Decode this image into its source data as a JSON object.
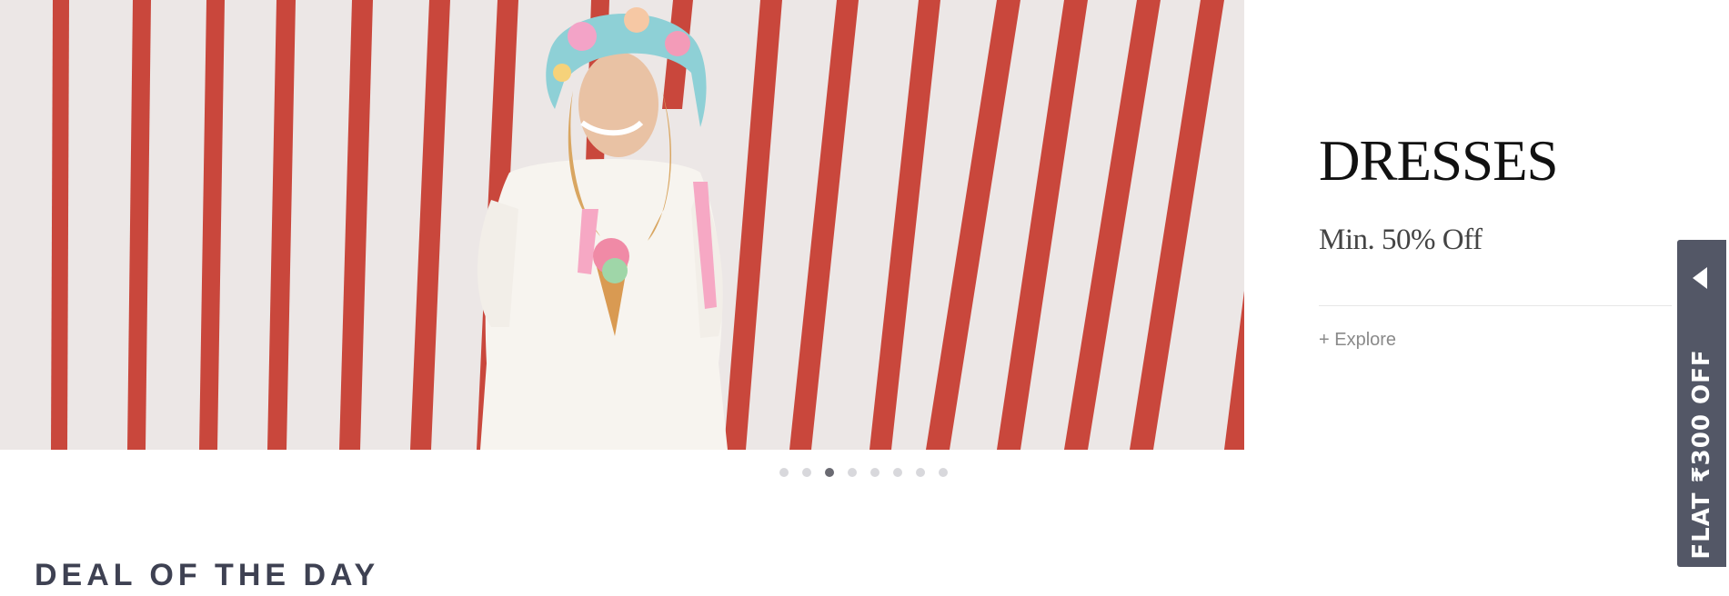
{
  "banner": {
    "title": "DRESSES",
    "subtitle": "Min. 50% Off",
    "cta_label": "+ Explore"
  },
  "carousel": {
    "total_slides": 8,
    "active_index": 2
  },
  "deal_section": {
    "heading": "DEAL OF THE DAY"
  },
  "offer_tab": {
    "label": "FLAT ₹300 OFF",
    "arrow_icon": "triangle-left-icon"
  },
  "colors": {
    "stripe": "#c9473c",
    "wall": "#ece7e6",
    "tab_background": "#535766",
    "heading_text": "#3e4152",
    "active_dot": "#6a6a72",
    "inactive_dot": "#d8d8dc"
  }
}
